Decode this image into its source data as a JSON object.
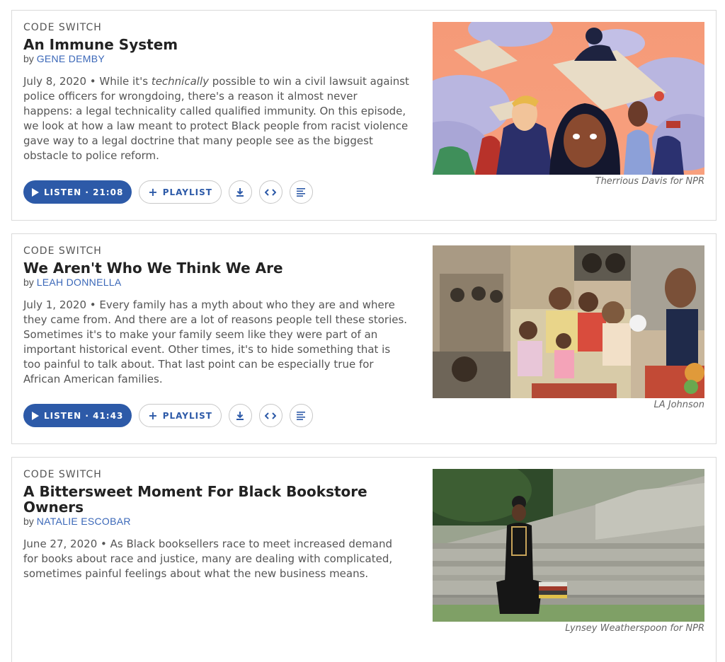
{
  "stories": [
    {
      "slug": "CODE SWITCH",
      "title": "An Immune System",
      "by": "by",
      "author": "GENE DEMBY",
      "date": "July 8, 2020",
      "teaser_pre": " • While it's ",
      "teaser_em": "technically",
      "teaser_post": " possible to win a civil lawsuit against police officers for wrongdoing, there's a reason it almost never happens: a legal technicality called qualified immunity. On this episode, we look at how a law meant to protect Black people from racist violence gave way to a legal doctrine that many people see as the biggest obstacle to police reform.",
      "listen_label": "LISTEN · 21:08",
      "playlist_label": "PLAYLIST",
      "credit": "Therrious Davis for NPR"
    },
    {
      "slug": "CODE SWITCH",
      "title": "We Aren't Who We Think We Are",
      "by": "by",
      "author": "LEAH DONNELLA",
      "date": "July 1, 2020",
      "teaser_pre": " • Every family has a myth about who they are and where they came from. And there are a lot of reasons people tell these stories. Sometimes it's to make your family seem like they were part of an important historical event. Other times, it's to hide something that is too painful to talk about. That last point can be especially true for African American families.",
      "teaser_em": "",
      "teaser_post": "",
      "listen_label": "LISTEN · 41:43",
      "playlist_label": "PLAYLIST",
      "credit": "LA Johnson"
    },
    {
      "slug": "CODE SWITCH",
      "title": "A Bittersweet Moment For Black Bookstore Owners",
      "by": "by",
      "author": "NATALIE ESCOBAR",
      "date": "June 27, 2020",
      "teaser_pre": " • As Black booksellers race to meet increased demand for books about race and justice, many are dealing with complicated, sometimes painful feelings about what the new business means.",
      "teaser_em": "",
      "teaser_post": "",
      "credit": "Lynsey Weatherspoon for NPR"
    }
  ],
  "icons": {
    "play": "play-icon",
    "plus": "plus-icon",
    "download": "download-icon",
    "embed": "embed-icon",
    "transcript": "transcript-icon"
  },
  "colors": {
    "accent": "#2d5aa8",
    "author_link": "#3a67b8"
  }
}
